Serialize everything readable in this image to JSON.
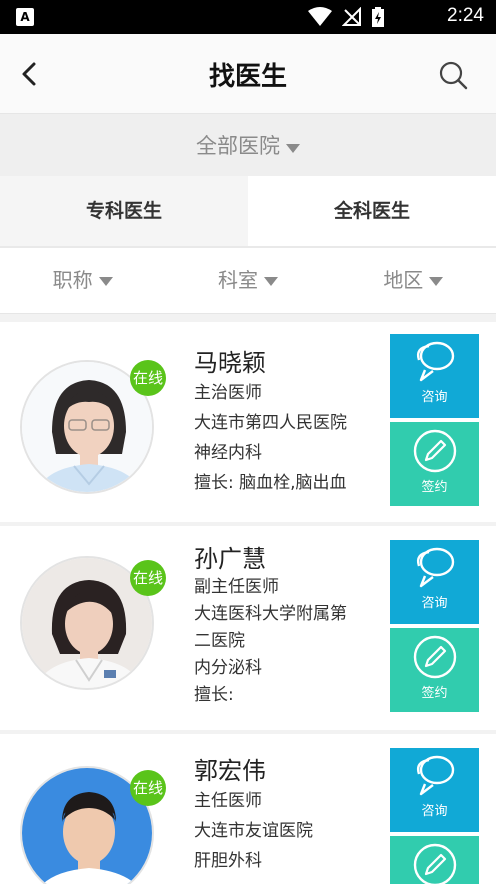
{
  "status_bar": {
    "time": "2:24",
    "left_icon": "A"
  },
  "header": {
    "title": "找医生"
  },
  "hospital_filter": {
    "label": "全部医院"
  },
  "tabs": [
    {
      "label": "专科医生"
    },
    {
      "label": "全科医生"
    }
  ],
  "filters": [
    {
      "label": "职称"
    },
    {
      "label": "科室"
    },
    {
      "label": "地区"
    }
  ],
  "doctors": [
    {
      "name": "马晓颖",
      "title": "主治医师",
      "hospital": "大连市第四人民医院",
      "department": "神经内科",
      "specialty": "擅长: 脑血栓,脑出血",
      "online": "在线",
      "consult": "咨询",
      "sign": "签约"
    },
    {
      "name": "孙广慧",
      "title": "副主任医师",
      "hospital_line1": "大连医科大学附属第",
      "hospital_line2": "二医院",
      "department": "内分泌科",
      "specialty": "擅长:",
      "online": "在线",
      "consult": "咨询",
      "sign": "签约"
    },
    {
      "name": "郭宏伟",
      "title": "主任医师",
      "hospital": "大连市友谊医院",
      "department": "肝胆外科",
      "online": "在线",
      "consult": "咨询"
    }
  ],
  "colors": {
    "consult": "#11a9d6",
    "sign": "#31ccae",
    "online": "#5ac41a"
  }
}
